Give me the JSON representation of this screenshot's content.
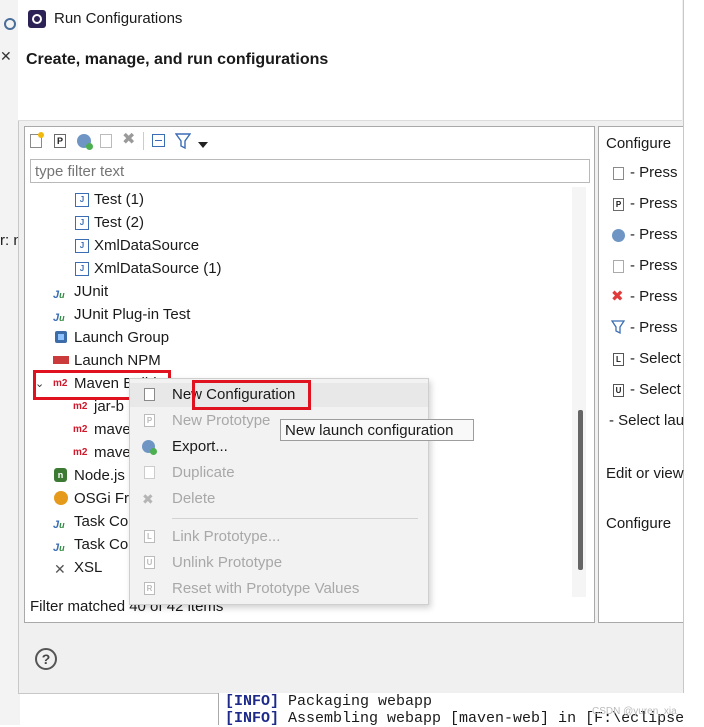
{
  "window": {
    "title": "Run Configurations",
    "banner_title": "Create, manage, and run configurations"
  },
  "toolbar": {
    "icons": [
      "new-config-icon",
      "new-prototype-icon",
      "export-icon",
      "duplicate-icon",
      "delete-icon",
      "collapse-all-icon",
      "filter-icon",
      "menu-dropdown-icon"
    ]
  },
  "filter": {
    "placeholder": "type filter text",
    "value": ""
  },
  "tree": {
    "items": [
      {
        "label": "Test (1)",
        "icon": "junit-config-icon"
      },
      {
        "label": "Test (2)",
        "icon": "junit-config-icon"
      },
      {
        "label": "XmlDataSource",
        "icon": "junit-config-icon"
      },
      {
        "label": "XmlDataSource (1)",
        "icon": "junit-config-icon"
      },
      {
        "label": "JUnit",
        "icon": "junit-icon"
      },
      {
        "label": "JUnit Plug-in Test",
        "icon": "junit-plugin-icon"
      },
      {
        "label": "Launch Group",
        "icon": "launch-group-icon"
      },
      {
        "label": "Launch NPM",
        "icon": "npm-icon"
      },
      {
        "label": "Maven Build",
        "icon": "maven-m2-icon",
        "expanded": true
      },
      {
        "label": "jar-b",
        "icon": "maven-m2-icon"
      },
      {
        "label": "mave",
        "icon": "maven-m2-icon"
      },
      {
        "label": "mave",
        "icon": "maven-m2-icon"
      },
      {
        "label": "Node.js",
        "icon": "nodejs-icon"
      },
      {
        "label": "OSGi Fr",
        "icon": "osgi-icon"
      },
      {
        "label": "Task Co",
        "icon": "task-context-icon"
      },
      {
        "label": "Task Co",
        "icon": "task-context-icon"
      },
      {
        "label": "XSL",
        "icon": "xsl-icon"
      }
    ],
    "status": "Filter matched 40 of 42 items"
  },
  "context_menu": {
    "items": [
      {
        "label": "New Configuration",
        "enabled": true,
        "highlighted": true
      },
      {
        "label": "New Prototype",
        "enabled": false
      },
      {
        "label": "Export...",
        "enabled": true
      },
      {
        "label": "Duplicate",
        "enabled": false
      },
      {
        "label": "Delete",
        "enabled": false
      },
      {
        "label": "Link Prototype...",
        "enabled": false
      },
      {
        "label": "Unlink Prototype",
        "enabled": false
      },
      {
        "label": "Reset with Prototype Values",
        "enabled": false
      }
    ]
  },
  "tooltip": {
    "text": "New launch configuration"
  },
  "right_pane": {
    "heading": "Configure",
    "rows": [
      "- Press",
      "- Press",
      "- Press",
      "- Press",
      "- Press",
      "- Press",
      "- Select",
      "- Select",
      "- Select lau"
    ],
    "edit_text": "Edit or view",
    "configure_text": "Configure"
  },
  "background": {
    "left_fragment": "r: n"
  },
  "console": {
    "lines": [
      {
        "tag": "[INFO]",
        "text": " Packaging webapp"
      },
      {
        "tag": "[INFO]",
        "text": " Assembling webapp [maven-web] in [F:\\eclipse"
      }
    ]
  },
  "watermark": "CSDN @yuren_xia",
  "colors": {
    "highlight_border": "#e0121f",
    "maven_red": "#d0182b"
  }
}
